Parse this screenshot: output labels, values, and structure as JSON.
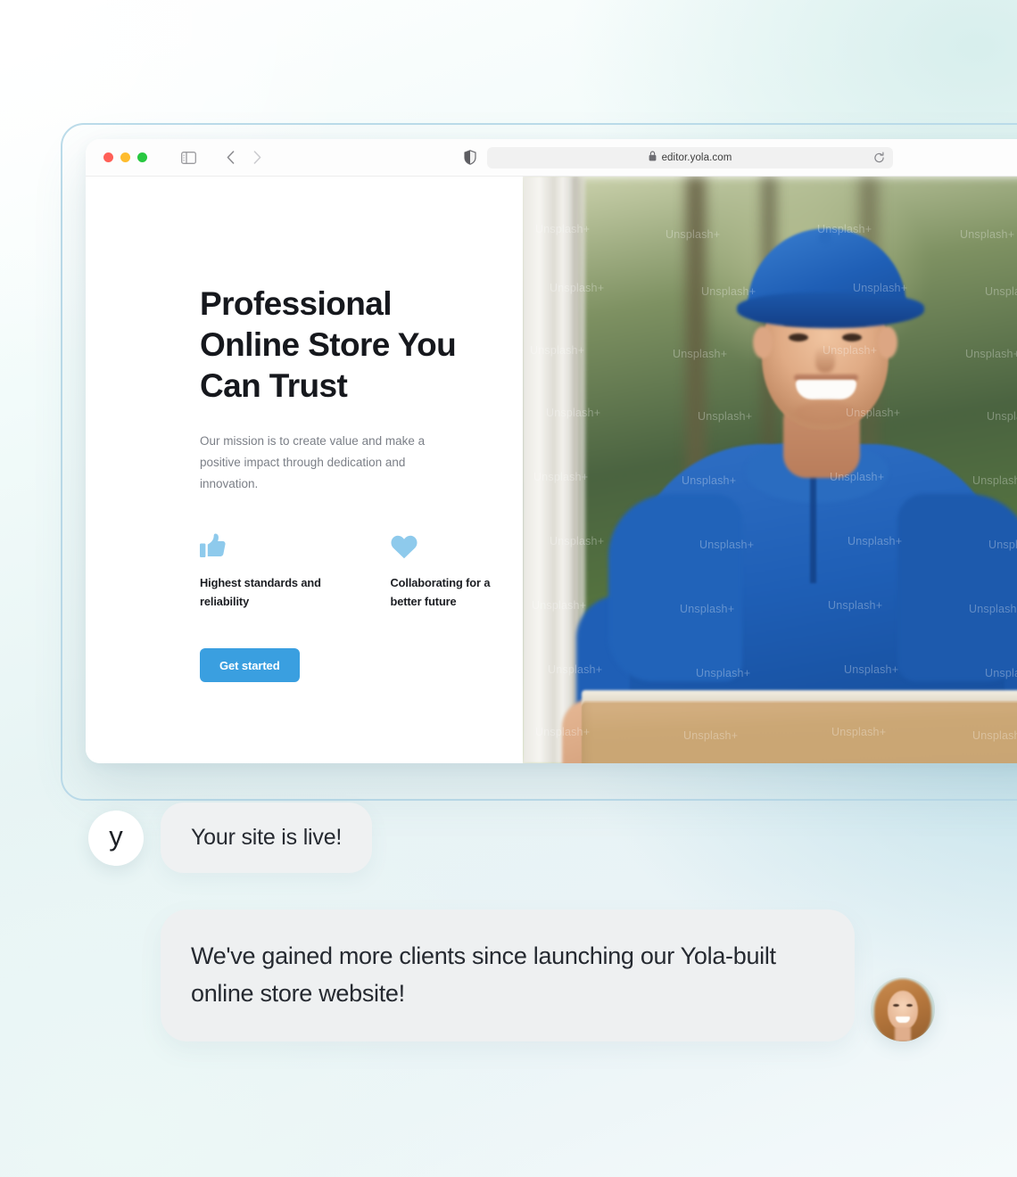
{
  "browser": {
    "traffic_lights": [
      "close",
      "minimize",
      "maximize"
    ],
    "sidebar_toggle_icon": "sidebar-toggle-icon",
    "back_icon": "chevron-left-icon",
    "forward_icon": "chevron-right-icon",
    "privacy_icon": "shield-icon",
    "lock_icon": "lock-icon",
    "url": "editor.yola.com",
    "reload_icon": "reload-icon"
  },
  "site": {
    "heading": "Professional Online Store You Can Trust",
    "subheading": "Our mission is to create value and make a positive impact through dedication and innovation.",
    "features": [
      {
        "icon": "thumbs-up-icon",
        "label": "Highest standards and reliability"
      },
      {
        "icon": "heart-icon",
        "label": "Collaborating for a better future"
      }
    ],
    "cta_label": "Get started",
    "photo_alt": "delivery-man-holding-cardboard-box",
    "photo_watermark": "Unsplash+"
  },
  "chat": {
    "yola_avatar_letter": "y",
    "message_1": "Your site is live!",
    "message_2": "We've gained more clients since launching our Yola-built online store website!",
    "client_avatar": "client-photo-avatar"
  },
  "colors": {
    "accent_blue": "#3a9fe0",
    "icon_blue": "#8ecaec",
    "frame_border": "#bcdcea",
    "bubble_bg": "#eef0f1",
    "heading": "#16181d",
    "body_text": "#7b7f87",
    "uniform_blue": "#1f5fb6",
    "box_kraft": "#c8a473"
  }
}
